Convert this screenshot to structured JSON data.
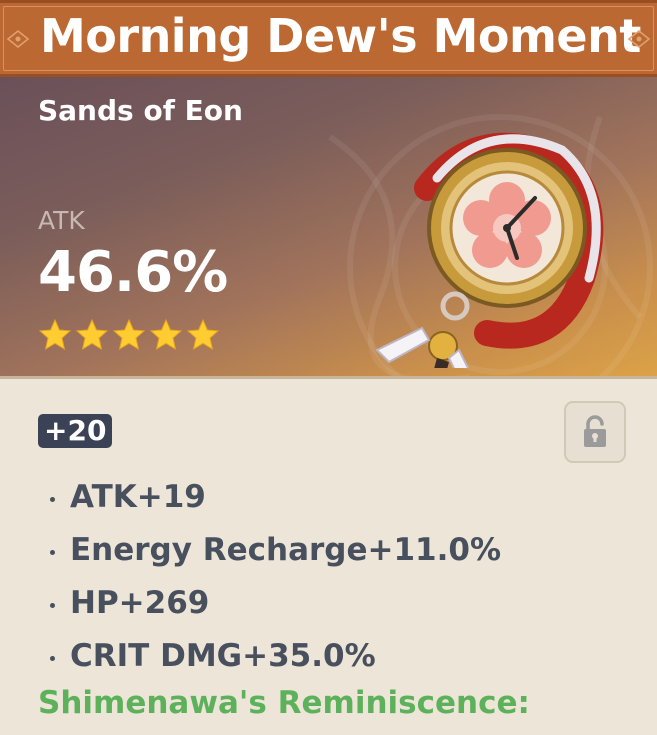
{
  "artifact": {
    "name": "Morning Dew's Moment",
    "type": "Sands of Eon",
    "main_stat": {
      "name": "ATK",
      "value": "46.6%"
    },
    "rarity": 5,
    "level": "+20",
    "locked": false,
    "substats": [
      "ATK+19",
      "Energy Recharge+11.0%",
      "HP+269",
      "CRIT DMG+35.0%"
    ],
    "set_name": "Shimenawa's Reminiscence:"
  },
  "icons": {
    "star": "star-icon",
    "lock": "unlocked-padlock-icon",
    "artifact": "pocket-watch-icon"
  },
  "colors": {
    "title_bar": "#bc6832",
    "header_gradient_start": "#6a5059",
    "header_gradient_end": "#dca347",
    "star": "#ffcc32",
    "level_badge": "#3b4255",
    "substat_text": "#48505e",
    "set_name": "#5cb15a",
    "body_bg": "#ece5d8"
  }
}
